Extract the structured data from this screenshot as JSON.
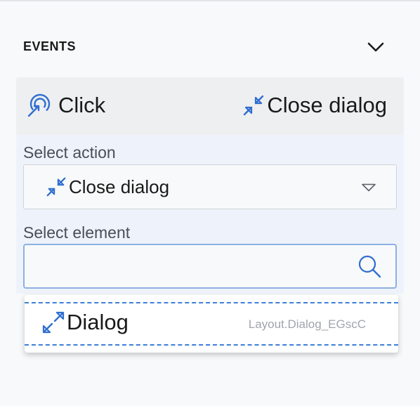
{
  "section": {
    "title": "EVENTS"
  },
  "event": {
    "trigger_label": "Click",
    "action_label": "Close dialog"
  },
  "action_field": {
    "label": "Select action",
    "value": "Close dialog"
  },
  "element_field": {
    "label": "Select element",
    "value": "",
    "placeholder": ""
  },
  "results": [
    {
      "name": "Dialog",
      "path": "Layout.Dialog_EGscC",
      "icon": "expand-arrows-icon"
    }
  ],
  "icons": {
    "collapse": "chevron-down-icon",
    "trigger": "tap-icon",
    "action": "compress-arrows-icon",
    "select": "triangle-down-icon",
    "search": "search-icon"
  },
  "colors": {
    "accent": "#2f6ecf",
    "panel": "#eef3fb",
    "header": "#eeeff1",
    "focus_border": "#8db0e4",
    "muted_text": "#a0a5ad"
  }
}
